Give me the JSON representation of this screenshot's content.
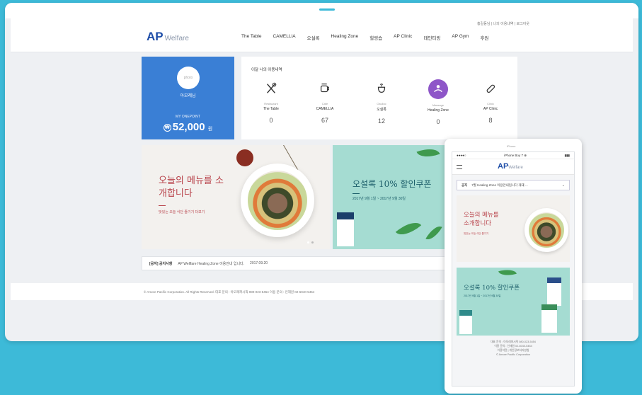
{
  "header": {
    "logo": "AP",
    "logo_sub": "Welfare",
    "util": "홍길동님 | 나의 이용내역 | 로그아웃",
    "nav": [
      "The Table",
      "CAMELLIA",
      "오설록",
      "Healing Zone",
      "힐링숍",
      "AP Clinic",
      "데인티링",
      "AP Gym",
      "후원"
    ]
  },
  "profile": {
    "avatar_text": "photo",
    "name": "아모레님",
    "points_label": "MY ONEPOINT",
    "currency": "₩",
    "points": "52,000",
    "unit": "원"
  },
  "usage": {
    "title": "이달 나의 이용내역",
    "items": [
      {
        "sub": "Restaurant",
        "name": "The Table",
        "count": "0",
        "icon": "fork-knife-icon"
      },
      {
        "sub": "Cafe",
        "name": "CAMELLIA",
        "count": "67",
        "icon": "cup-icon"
      },
      {
        "sub": "Osulloc",
        "name": "오설록",
        "count": "12",
        "icon": "tea-icon"
      },
      {
        "sub": "Massage",
        "name": "Healing Zone",
        "count": "0",
        "icon": "massage-icon"
      },
      {
        "sub": "Clinic",
        "name": "AP Clinic",
        "count": "8",
        "icon": "pill-icon"
      }
    ]
  },
  "banner1": {
    "title": "오늘의 메뉴를 소개합니다",
    "sub": "맛있는 오늘 식단 즐기기 더보기"
  },
  "banner2": {
    "title": "오설록 10% 할인쿠폰",
    "sub": "2017년 9월 1일 ~ 2017년 9월 30일"
  },
  "notice": {
    "label": "[공지] 공지사항",
    "text": "AP Wellfare Healing Zone 이용안내 입니다.",
    "date": "2017.09.20"
  },
  "footer": {
    "text": "© Amore Pacific Corporation. All Rights Reserved.    대표 문의 : 아모레퍼시픽 080-023-5454    이용 문의 : 인재원 02-6040-5454"
  },
  "mobile": {
    "speaker": "iPhone",
    "status_left": "●●●●○",
    "status_center": "iPhone Boy 7 ⊕",
    "status_right": "▮▮▮",
    "select_label": "공지",
    "select_value": "7월 Healing Zone 이용안내입니다 개돼 ...",
    "banner1_title": "오늘의 메뉴를 소개합니다",
    "banner1_sub": "맛있는 오늘 식단 즐기기",
    "banner2_title": "오설록 10% 할인쿠폰",
    "banner2_sub": "2017년 9월 1일 ~ 2017년 9월 30일",
    "footer_lines": [
      "대표 문의 : 아모레퍼시픽 080-023-5454",
      "이용 문의 : 인재원 02-6040-5454",
      "이용약관 | 개인정보처리방침",
      "© Amore Pacific Corporation"
    ]
  }
}
